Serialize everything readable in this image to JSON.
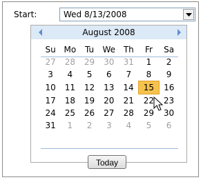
{
  "field": {
    "label": "Start:",
    "value": "Wed 8/13/2008"
  },
  "calendar": {
    "month_title": "August 2008",
    "weekdays": [
      "Su",
      "Mo",
      "Tu",
      "We",
      "Th",
      "Fr",
      "Sa"
    ],
    "weeks": [
      [
        {
          "d": "27",
          "other": true
        },
        {
          "d": "28",
          "other": true
        },
        {
          "d": "29",
          "other": true
        },
        {
          "d": "30",
          "other": true
        },
        {
          "d": "31",
          "other": true
        },
        {
          "d": "1"
        },
        {
          "d": "2"
        }
      ],
      [
        {
          "d": "3"
        },
        {
          "d": "4"
        },
        {
          "d": "5"
        },
        {
          "d": "6"
        },
        {
          "d": "7"
        },
        {
          "d": "8"
        },
        {
          "d": "9"
        }
      ],
      [
        {
          "d": "10"
        },
        {
          "d": "11"
        },
        {
          "d": "12"
        },
        {
          "d": "13"
        },
        {
          "d": "14"
        },
        {
          "d": "15",
          "selected": true
        },
        {
          "d": "16"
        }
      ],
      [
        {
          "d": "17"
        },
        {
          "d": "18"
        },
        {
          "d": "19"
        },
        {
          "d": "20"
        },
        {
          "d": "21"
        },
        {
          "d": "22"
        },
        {
          "d": "23"
        }
      ],
      [
        {
          "d": "24"
        },
        {
          "d": "25"
        },
        {
          "d": "26"
        },
        {
          "d": "27"
        },
        {
          "d": "28"
        },
        {
          "d": "29"
        },
        {
          "d": "30"
        }
      ],
      [
        {
          "d": "31"
        },
        {
          "d": "1",
          "other": true
        },
        {
          "d": "2",
          "other": true
        },
        {
          "d": "3",
          "other": true
        },
        {
          "d": "4",
          "other": true
        },
        {
          "d": "5",
          "other": true
        },
        {
          "d": "6",
          "other": true
        }
      ]
    ],
    "today_label": "Today"
  },
  "icons": {
    "prev": "chevron-left-icon",
    "next": "chevron-right-icon",
    "dropdown": "caret-down-icon",
    "cursor": "mouse-pointer-icon"
  },
  "colors": {
    "header_bg": "#dce9f6",
    "arrow": "#5b8fd3",
    "selected_bg": "#f5c24d",
    "other_month": "#a0a0a0"
  }
}
